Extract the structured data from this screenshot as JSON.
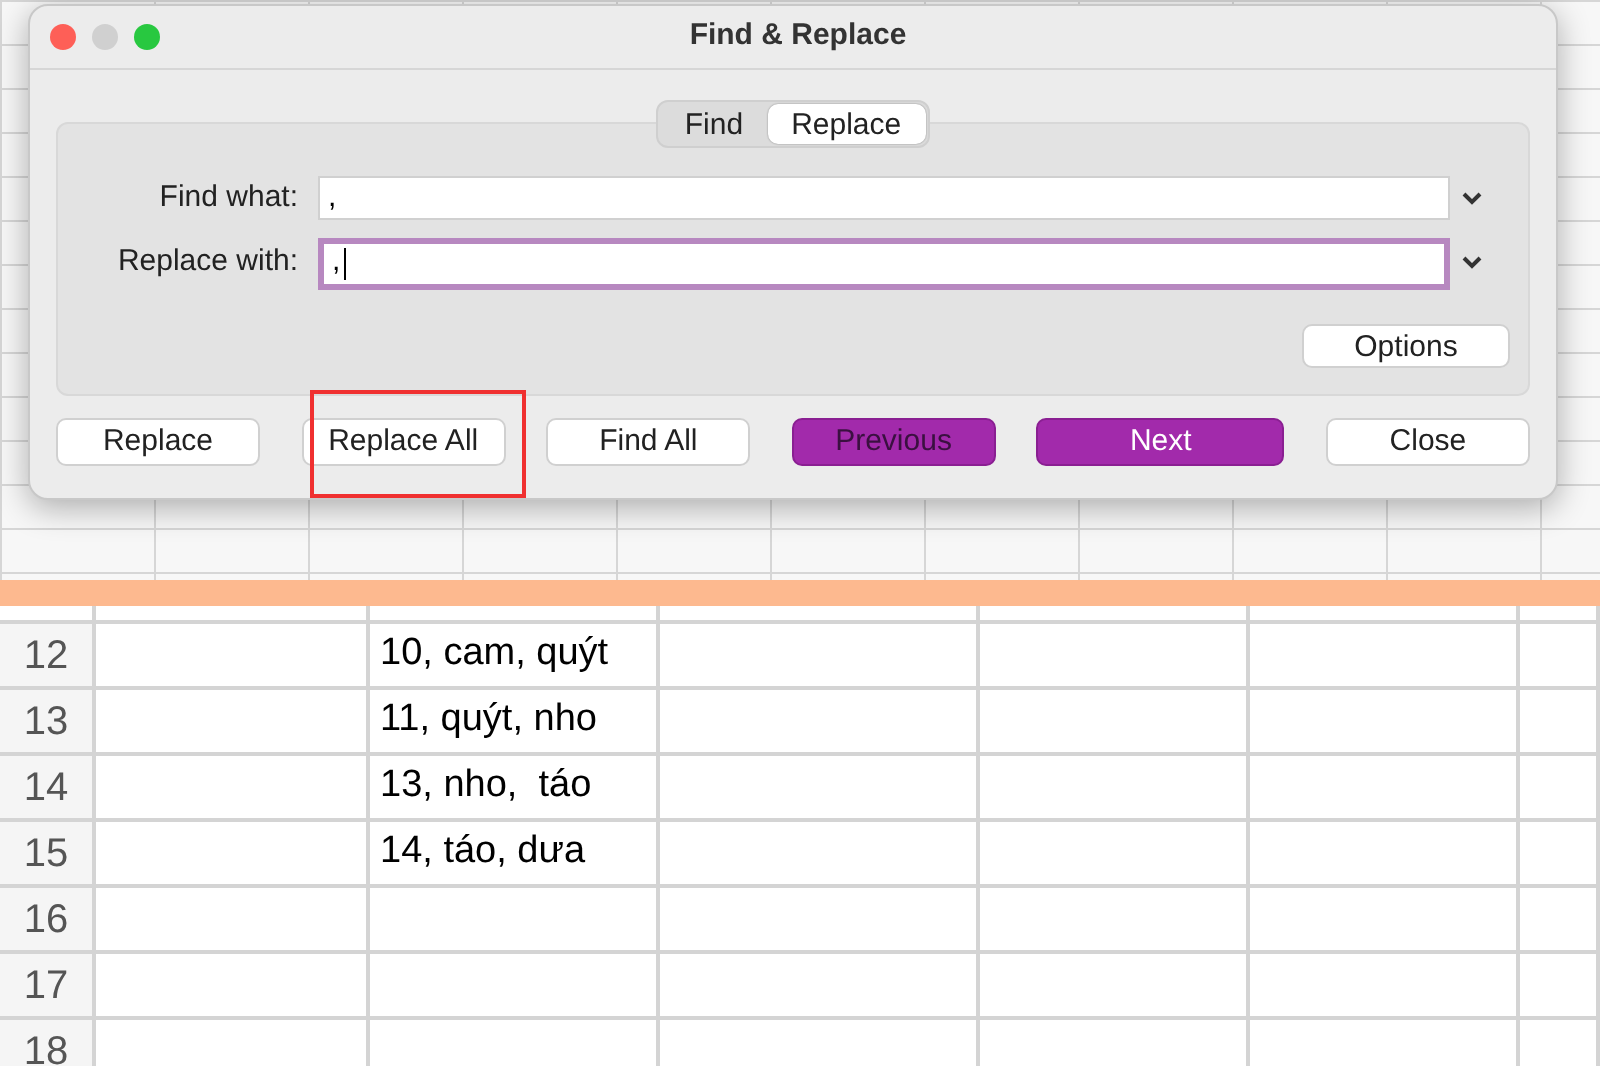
{
  "dialog": {
    "title": "Find & Replace",
    "tabs": [
      {
        "label": "Find",
        "selected": false
      },
      {
        "label": "Replace",
        "selected": true
      }
    ],
    "fields": [
      {
        "label": "Find what:",
        "value": ",",
        "focused": false
      },
      {
        "label": "Replace with:",
        "value": ",",
        "focused": true
      }
    ],
    "options_button": "Options",
    "buttons": [
      {
        "label": "Replace",
        "kind": "plain",
        "highlighted": false
      },
      {
        "label": "Replace All",
        "kind": "plain",
        "highlighted": true
      },
      {
        "label": "Find All",
        "kind": "plain",
        "highlighted": false
      },
      {
        "label": "Previous",
        "kind": "accent-dim",
        "highlighted": false
      },
      {
        "label": "Next",
        "kind": "accent",
        "highlighted": false
      },
      {
        "label": "Close",
        "kind": "plain",
        "highlighted": false
      }
    ]
  },
  "sheet": {
    "rows": [
      {
        "number": "12",
        "cells": [
          "",
          "10, cam, quýt"
        ]
      },
      {
        "number": "13",
        "cells": [
          "",
          "11, quýt, nho"
        ]
      },
      {
        "number": "14",
        "cells": [
          "",
          "13, nho,  táo"
        ]
      },
      {
        "number": "15",
        "cells": [
          "",
          "14, táo, dưa"
        ]
      },
      {
        "number": "16",
        "cells": [
          "",
          ""
        ]
      },
      {
        "number": "17",
        "cells": [
          "",
          ""
        ]
      },
      {
        "number": "18",
        "cells": [
          "",
          ""
        ]
      }
    ]
  }
}
